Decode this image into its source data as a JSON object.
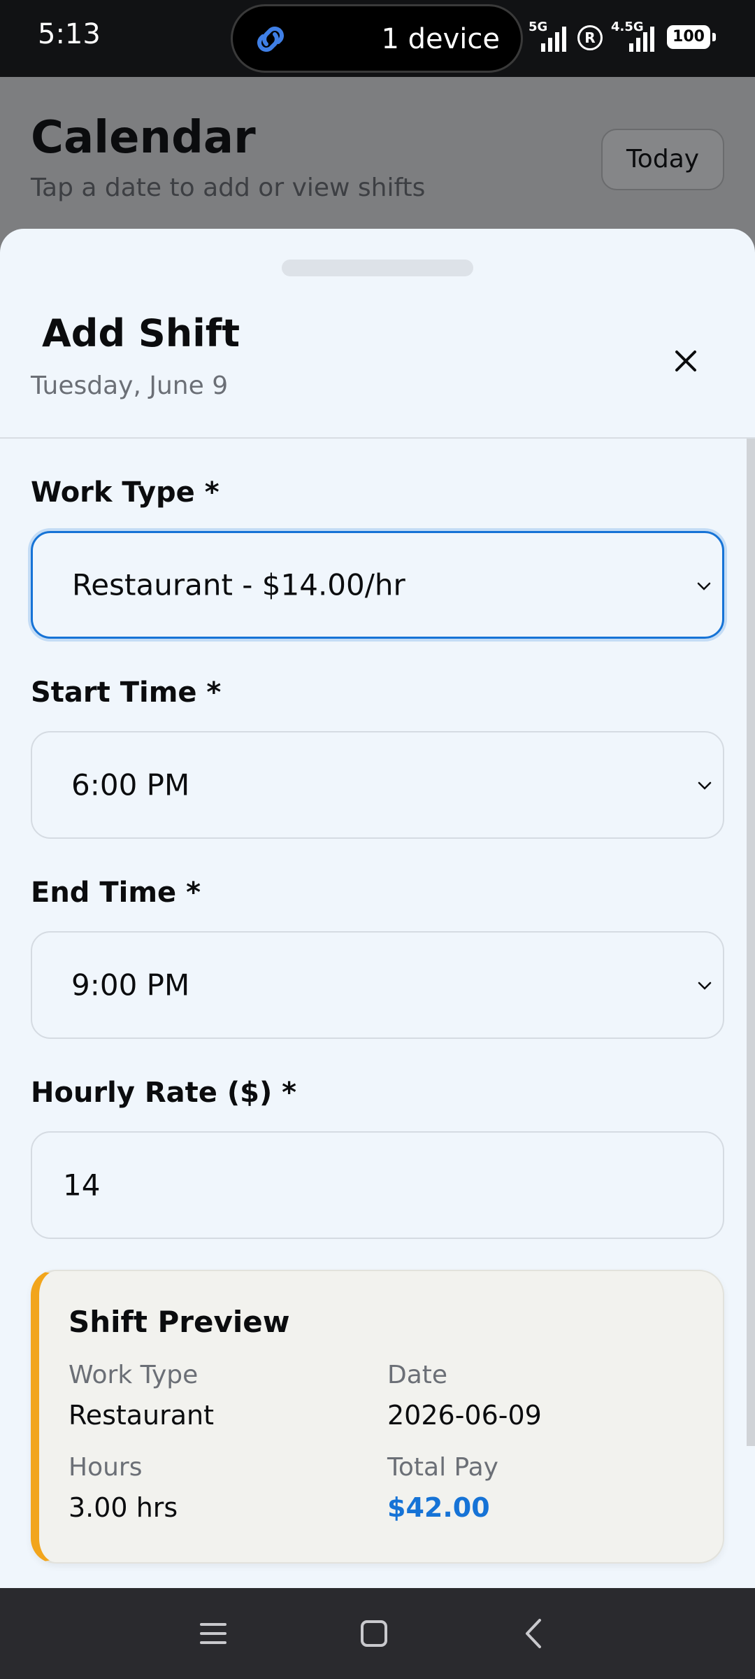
{
  "status_bar": {
    "time": "5:13",
    "island_text": "1 device",
    "signal1_label": "5G",
    "signal2_label": "4.5G",
    "reg_mark": "R",
    "battery": "100"
  },
  "background_page": {
    "title": "Calendar",
    "subtitle": "Tap a date to add or view shifts",
    "today_button": "Today"
  },
  "sheet": {
    "title": "Add Shift",
    "date": "Tuesday, June 9",
    "close_icon": "close-icon"
  },
  "form": {
    "work_type_label": "Work Type *",
    "work_type_value": "Restaurant - $14.00/hr",
    "start_time_label": "Start Time *",
    "start_time_value": "6:00 PM",
    "end_time_label": "End Time *",
    "end_time_value": "9:00 PM",
    "hourly_rate_label": "Hourly Rate ($) *",
    "hourly_rate_value": "14"
  },
  "preview": {
    "title": "Shift Preview",
    "work_type_label": "Work Type",
    "work_type_value": "Restaurant",
    "date_label": "Date",
    "date_value": "2026-06-09",
    "hours_label": "Hours",
    "hours_value": "3.00 hrs",
    "total_pay_label": "Total Pay",
    "total_pay_value": "$42.00"
  },
  "colors": {
    "accent": "#1673d6",
    "preview_stripe": "#f2a51c",
    "sheet_bg": "#f0f6fc"
  },
  "nav_bar": {
    "icons": [
      "menu-icon",
      "home-icon",
      "back-icon"
    ]
  }
}
